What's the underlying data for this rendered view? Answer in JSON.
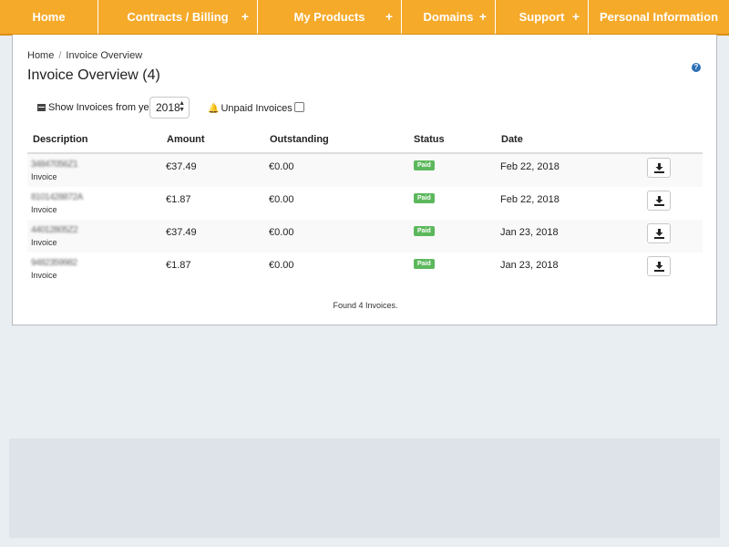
{
  "nav": {
    "items": [
      {
        "label": "Home",
        "plus": ""
      },
      {
        "label": "Contracts / Billing",
        "plus": "+"
      },
      {
        "label": "My Products",
        "plus": "+"
      },
      {
        "label": "Domains",
        "plus": "+"
      },
      {
        "label": "Support",
        "plus": "+"
      },
      {
        "label": "Personal Information",
        "plus": ""
      }
    ]
  },
  "breadcrumb": {
    "home": "Home",
    "separator": "/",
    "current": "Invoice Overview"
  },
  "page_title": "Invoice Overview (4)",
  "help_icon": "?",
  "filters": {
    "show_label": "Show Invoices from year",
    "year_value": "2018",
    "unpaid_label": "Unpaid Invoices"
  },
  "table": {
    "headers": [
      "Description",
      "Amount",
      "Outstanding",
      "Status",
      "Date"
    ],
    "rows": [
      {
        "number": "34847056Z1",
        "type": "Invoice",
        "amount": "€37.49",
        "outstanding": "€0.00",
        "status": "Paid",
        "date": "Feb 22, 2018"
      },
      {
        "number": "8101428872A",
        "type": "Invoice",
        "amount": "€1.87",
        "outstanding": "€0.00",
        "status": "Paid",
        "date": "Feb 22, 2018"
      },
      {
        "number": "44012805Z2",
        "type": "Invoice",
        "amount": "€37.49",
        "outstanding": "€0.00",
        "status": "Paid",
        "date": "Jan 23, 2018"
      },
      {
        "number": "9482359982",
        "type": "Invoice",
        "amount": "€1.87",
        "outstanding": "€0.00",
        "status": "Paid",
        "date": "Jan 23, 2018"
      }
    ]
  },
  "footer_note": "Found 4 Invoices.",
  "colors": {
    "nav": "#f5aa2a",
    "paid_badge": "#5cb85c",
    "help": "#2a6fb5"
  }
}
